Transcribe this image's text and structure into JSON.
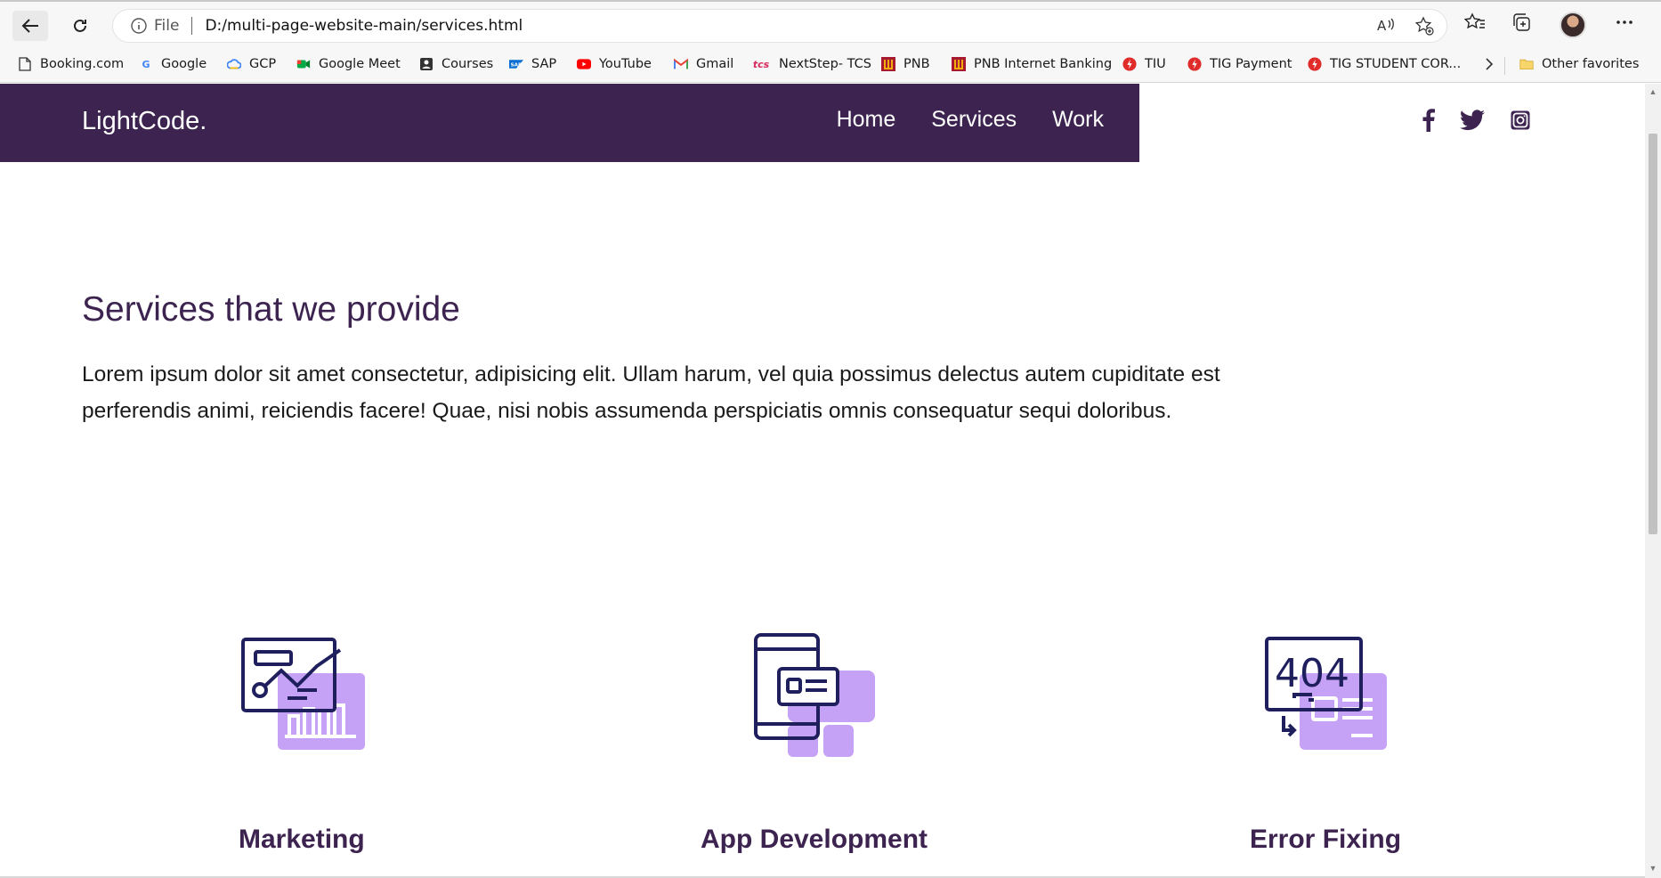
{
  "browser": {
    "address": {
      "scheme_label": "File",
      "url": "D:/multi-page-website-main/services.html"
    },
    "bookmarks": [
      {
        "label": "Booking.com",
        "icon": "page-icon"
      },
      {
        "label": "Google",
        "icon": "google-icon"
      },
      {
        "label": "GCP",
        "icon": "gcp-icon"
      },
      {
        "label": "Google Meet",
        "icon": "meet-icon"
      },
      {
        "label": "Courses",
        "icon": "courses-icon"
      },
      {
        "label": "SAP",
        "icon": "sap-icon"
      },
      {
        "label": "YouTube",
        "icon": "youtube-icon"
      },
      {
        "label": "Gmail",
        "icon": "gmail-icon"
      },
      {
        "label": "NextStep- TCS",
        "icon": "tcs-icon"
      },
      {
        "label": "PNB",
        "icon": "pnb-icon"
      },
      {
        "label": "PNB Internet Banking",
        "icon": "pnb-icon"
      },
      {
        "label": "TIU",
        "icon": "tiu-icon"
      },
      {
        "label": "TIG Payment",
        "icon": "tiu-icon"
      },
      {
        "label": "TIG STUDENT COR...",
        "icon": "tiu-icon"
      }
    ],
    "other_favorites": "Other favorites"
  },
  "site": {
    "logo": "LightCode.",
    "nav": [
      "Home",
      "Services",
      "Work"
    ],
    "brand_color": "#3d234f",
    "accent_color": "#c5a2f5"
  },
  "content": {
    "title": "Services that we provide",
    "text_line1": "Lorem ipsum dolor sit amet consectetur, adipisicing elit. Ullam harum, vel quia possimus delectus autem cupiditate est",
    "text_line2": "perferendis animi, reiciendis facere! Quae, nisi nobis assumenda perspiciatis omnis consequatur sequi doloribus.",
    "services": [
      {
        "title": "Marketing",
        "icon": "marketing-chart-icon"
      },
      {
        "title": "App Development",
        "icon": "mobile-app-icon"
      },
      {
        "title": "Error Fixing",
        "icon": "error-404-icon"
      }
    ]
  }
}
